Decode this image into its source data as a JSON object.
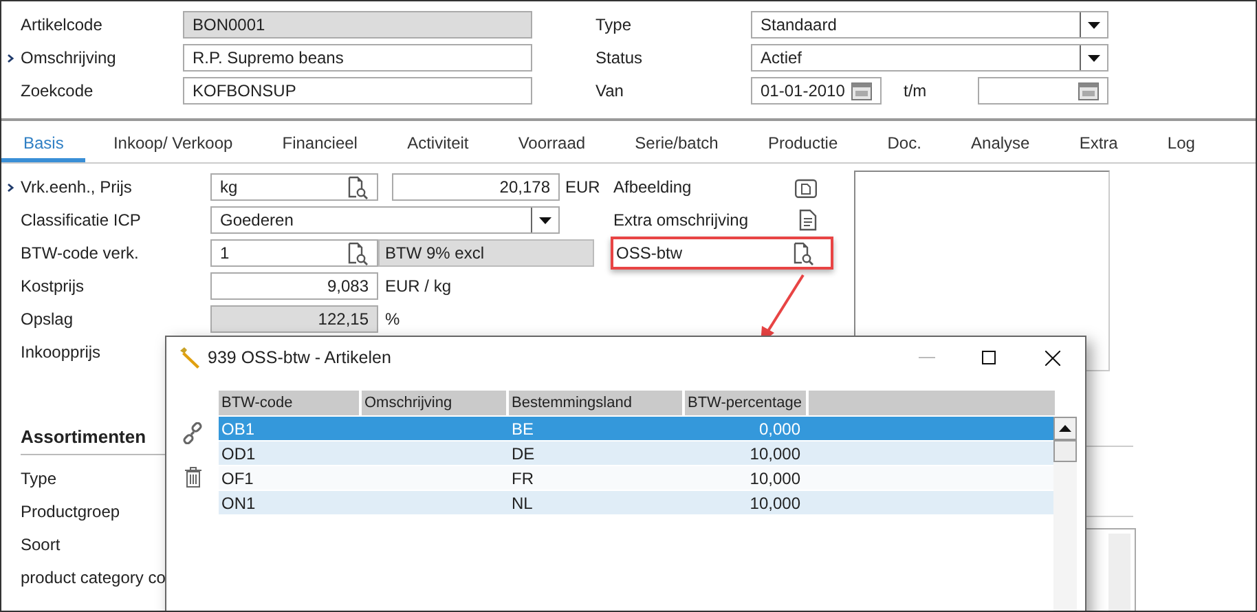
{
  "header": {
    "left": [
      {
        "label": "Artikelcode",
        "value": "BON0001",
        "readonly": true,
        "marker": false
      },
      {
        "label": "Omschrijving",
        "value": "R.P. Supremo beans",
        "readonly": false,
        "marker": true
      },
      {
        "label": "Zoekcode",
        "value": "KOFBONSUP",
        "readonly": false,
        "marker": false
      }
    ],
    "right": [
      {
        "kind": "select",
        "label": "Type",
        "value": "Standaard"
      },
      {
        "kind": "select",
        "label": "Status",
        "value": "Actief"
      },
      {
        "kind": "daterange",
        "label": "Van",
        "value": "01-01-2010",
        "to_label": "t/m"
      }
    ]
  },
  "tabs": [
    {
      "label": "Basis",
      "selected": true
    },
    {
      "label": "Inkoop/ Verkoop",
      "selected": false
    },
    {
      "label": "Financieel",
      "selected": false
    },
    {
      "label": "Activiteit",
      "selected": false
    },
    {
      "label": "Voorraad",
      "selected": false
    },
    {
      "label": "Serie/batch",
      "selected": false
    },
    {
      "label": "Productie",
      "selected": false
    },
    {
      "label": "Doc.",
      "selected": false
    },
    {
      "label": "Analyse",
      "selected": false
    },
    {
      "label": "Extra",
      "selected": false
    },
    {
      "label": "Log",
      "selected": false
    }
  ],
  "basis": [
    {
      "kind": "lookup_amount",
      "label": "Vrk.eenh., Prijs",
      "marker": true,
      "value": "kg",
      "amount": "20,178",
      "unit": "EUR"
    },
    {
      "kind": "select",
      "label": "Classificatie ICP",
      "marker": false,
      "value": "Goederen"
    },
    {
      "kind": "lookup_desc",
      "label": "BTW-code verk.",
      "marker": false,
      "value": "1",
      "description": "BTW 9% excl"
    },
    {
      "kind": "number",
      "label": "Kostprijs",
      "marker": false,
      "value": "9,083",
      "unit": "EUR / kg",
      "readonly": false
    },
    {
      "kind": "number",
      "label": "Opslag",
      "marker": false,
      "value": "122,15",
      "unit": "%",
      "readonly": true
    },
    {
      "kind": "label",
      "label": "Inkoopprijs",
      "marker": false
    }
  ],
  "links": [
    {
      "label": "Afbeelding",
      "kind": "image",
      "highlighted": false
    },
    {
      "label": "Extra omschrijving",
      "kind": "text",
      "highlighted": false
    },
    {
      "label": "OSS-btw",
      "kind": "lookup",
      "highlighted": true
    }
  ],
  "assortimenten": {
    "title": "Assortimenten",
    "fields": [
      "Type",
      "Productgroep",
      "Soort",
      "product category co"
    ]
  },
  "dialog": {
    "title": "939 OSS-btw - Artikelen",
    "columns": [
      "BTW-code",
      "Omschrijving",
      "Bestemmingsland",
      "BTW-percentage"
    ],
    "rows": [
      {
        "btw_code": "OB1",
        "land": "BE",
        "percentage": "0,000",
        "selected": true
      },
      {
        "btw_code": "OD1",
        "land": "DE",
        "percentage": "10,000",
        "selected": false
      },
      {
        "btw_code": "OF1",
        "land": "FR",
        "percentage": "10,000",
        "selected": false
      },
      {
        "btw_code": "ON1",
        "land": "NL",
        "percentage": "10,000",
        "selected": false
      }
    ]
  }
}
